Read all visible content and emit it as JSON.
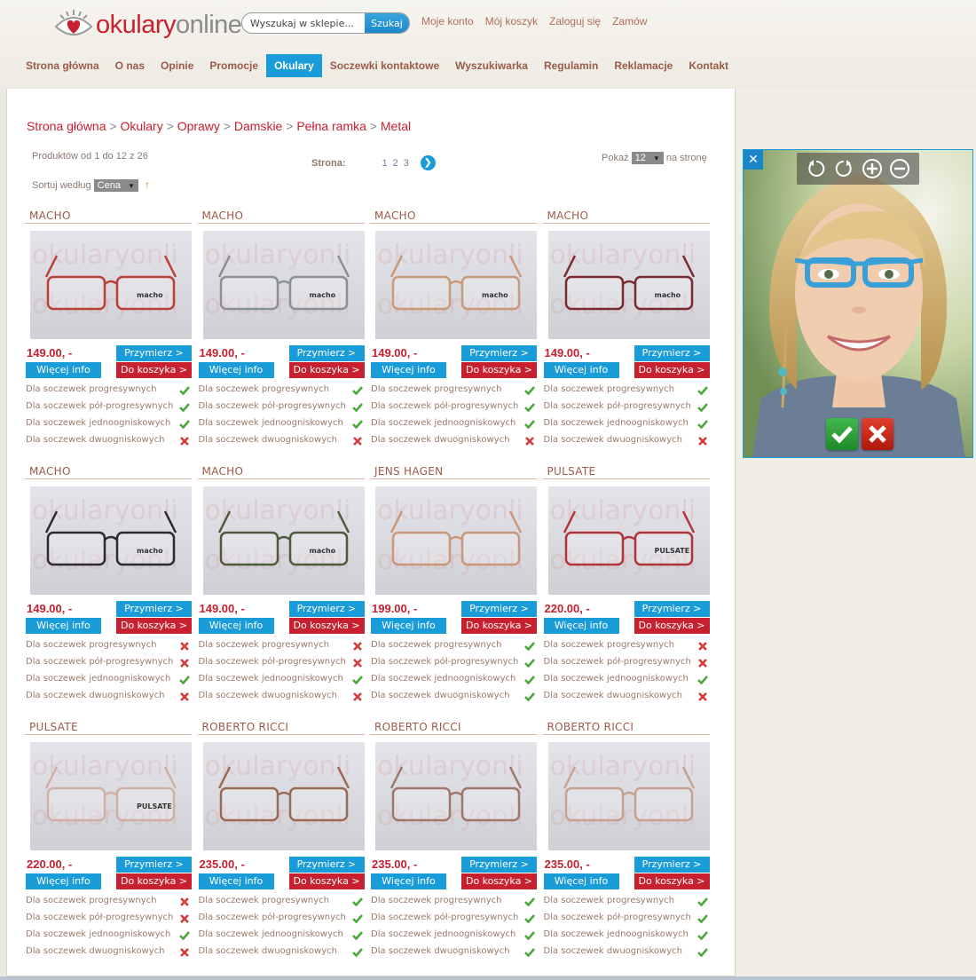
{
  "brand": {
    "part1": "okulary",
    "part2": "online"
  },
  "search": {
    "placeholder": "Wyszukaj w sklepie...",
    "button": "Szukaj"
  },
  "toplinks": [
    "Moje konto",
    "Mój koszyk",
    "Zaloguj się",
    "Zamów"
  ],
  "nav": [
    {
      "label": "Strona główna",
      "active": false
    },
    {
      "label": "O nas",
      "active": false
    },
    {
      "label": "Opinie",
      "active": false
    },
    {
      "label": "Promocje",
      "active": false
    },
    {
      "label": "Okulary",
      "active": true
    },
    {
      "label": "Soczewki kontaktowe",
      "active": false
    },
    {
      "label": "Wyszukiwarka",
      "active": false
    },
    {
      "label": "Regulamin",
      "active": false
    },
    {
      "label": "Reklamacje",
      "active": false
    },
    {
      "label": "Kontakt",
      "active": false
    }
  ],
  "breadcrumb": [
    "Strona główna",
    "Okulary",
    "Oprawy",
    "Damskie",
    "Pełna ramka",
    "Metal"
  ],
  "breadcrumb_sep": " > ",
  "listing": {
    "count_text": "Produktów od 1 do 12 z 26",
    "page_label": "Strona:",
    "pages": [
      "1",
      "2",
      "3"
    ],
    "show_label": "Pokaż",
    "per_page": "12",
    "per_page_suffix": "na stronę",
    "sort_label": "Sortuj według",
    "sort_value": "Cena"
  },
  "labels": {
    "try": "Przymierz >",
    "info": "Więcej info",
    "cart": "Do koszyka >",
    "feature_names": [
      "Dla soczewek progresywnych",
      "Dla soczewek pół-progresywnych",
      "Dla soczewek jednoogniskowych",
      "Dla soczewek dwuogniskowych"
    ],
    "watermark": "okularyonli"
  },
  "products": [
    {
      "brand": "MACHO",
      "price": "149.00, -",
      "features": [
        true,
        true,
        true,
        false
      ],
      "frame": "#b8413a",
      "logo": "macho"
    },
    {
      "brand": "MACHO",
      "price": "149.00, -",
      "features": [
        true,
        true,
        true,
        false
      ],
      "frame": "#8b8f96",
      "logo": "macho"
    },
    {
      "brand": "MACHO",
      "price": "149.00, -",
      "features": [
        true,
        true,
        true,
        false
      ],
      "frame": "#c89a7a",
      "logo": "macho"
    },
    {
      "brand": "MACHO",
      "price": "149.00, -",
      "features": [
        true,
        true,
        true,
        false
      ],
      "frame": "#7a2a30",
      "logo": "macho"
    },
    {
      "brand": "MACHO",
      "price": "149.00, -",
      "features": [
        false,
        false,
        true,
        false
      ],
      "frame": "#2a2a30",
      "logo": "macho"
    },
    {
      "brand": "MACHO",
      "price": "149.00, -",
      "features": [
        false,
        false,
        true,
        false
      ],
      "frame": "#4e5a3a",
      "logo": "macho"
    },
    {
      "brand": "JENS HAGEN",
      "price": "199.00, -",
      "features": [
        true,
        true,
        true,
        true
      ],
      "frame": "#c9987a",
      "logo": ""
    },
    {
      "brand": "PULSATE",
      "price": "220.00, -",
      "features": [
        false,
        false,
        true,
        false
      ],
      "frame": "#b2343a",
      "logo": "PULSATE"
    },
    {
      "brand": "PULSATE",
      "price": "220.00, -",
      "features": [
        false,
        false,
        true,
        false
      ],
      "frame": "#d0b0a6",
      "logo": "PULSATE"
    },
    {
      "brand": "ROBERTO RICCI",
      "price": "235.00, -",
      "features": [
        true,
        true,
        true,
        true
      ],
      "frame": "#9a6a52",
      "logo": ""
    },
    {
      "brand": "ROBERTO RICCI",
      "price": "235.00, -",
      "features": [
        true,
        true,
        true,
        true
      ],
      "frame": "#a0786a",
      "logo": ""
    },
    {
      "brand": "ROBERTO RICCI",
      "price": "235.00, -",
      "features": [
        true,
        true,
        true,
        true
      ],
      "frame": "#c8a090",
      "logo": ""
    }
  ],
  "tryon": {
    "close_icon": "close-icon",
    "tools": [
      "rotate-left-icon",
      "rotate-right-icon",
      "zoom-in-icon",
      "zoom-out-icon"
    ],
    "glasses_color": "#3aa0d8"
  },
  "colors": {
    "accent": "#1a9cd8",
    "brand_red": "#c8202f",
    "nav_text": "#9a5b47"
  }
}
